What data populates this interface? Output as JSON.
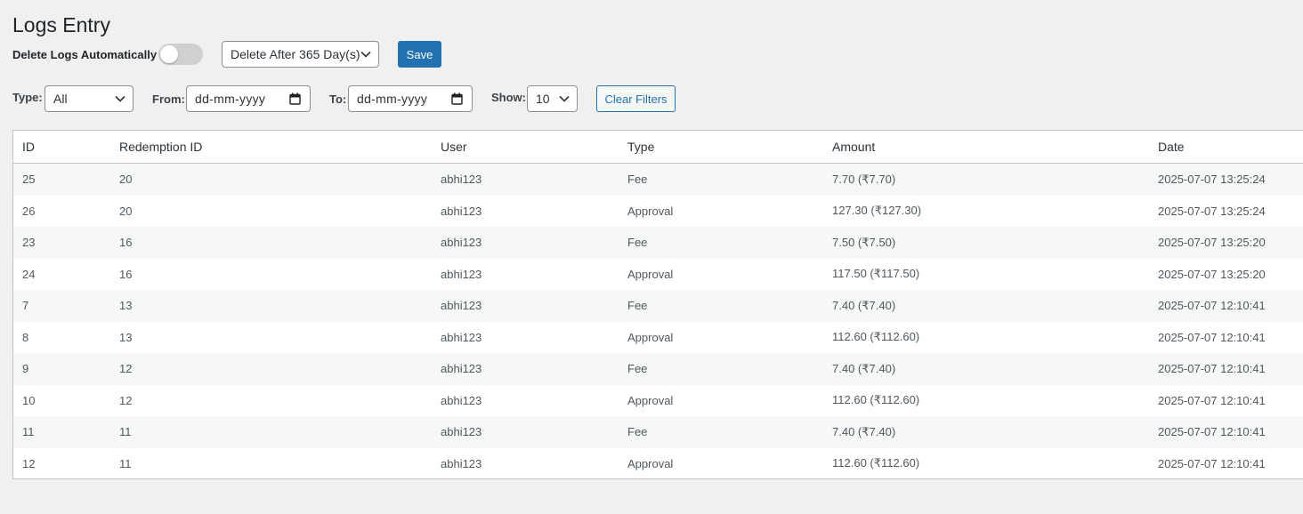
{
  "page": {
    "title": "Logs Entry"
  },
  "settings": {
    "auto_delete_label": "Delete Logs Automatically",
    "auto_delete_enabled": false,
    "delete_after_value": "Delete After 365 Day(s)",
    "save_label": "Save"
  },
  "filters": {
    "type_label": "Type:",
    "type_value": "All",
    "from_label": "From:",
    "from_placeholder": "dd-mm-yyyy",
    "to_label": "To:",
    "to_placeholder": "dd-mm-yyyy",
    "show_label": "Show:",
    "show_value": "10",
    "clear_label": "Clear Filters"
  },
  "table": {
    "headers": [
      "ID",
      "Redemption ID",
      "User",
      "Type",
      "Amount",
      "Date"
    ],
    "rows": [
      [
        "25",
        "20",
        "abhi123",
        "Fee",
        "7.70 (₹7.70)",
        "2025-07-07 13:25:24"
      ],
      [
        "26",
        "20",
        "abhi123",
        "Approval",
        "127.30 (₹127.30)",
        "2025-07-07 13:25:24"
      ],
      [
        "23",
        "16",
        "abhi123",
        "Fee",
        "7.50 (₹7.50)",
        "2025-07-07 13:25:20"
      ],
      [
        "24",
        "16",
        "abhi123",
        "Approval",
        "117.50 (₹117.50)",
        "2025-07-07 13:25:20"
      ],
      [
        "7",
        "13",
        "abhi123",
        "Fee",
        "7.40 (₹7.40)",
        "2025-07-07 12:10:41"
      ],
      [
        "8",
        "13",
        "abhi123",
        "Approval",
        "112.60 (₹112.60)",
        "2025-07-07 12:10:41"
      ],
      [
        "9",
        "12",
        "abhi123",
        "Fee",
        "7.40 (₹7.40)",
        "2025-07-07 12:10:41"
      ],
      [
        "10",
        "12",
        "abhi123",
        "Approval",
        "112.60 (₹112.60)",
        "2025-07-07 12:10:41"
      ],
      [
        "11",
        "11",
        "abhi123",
        "Fee",
        "7.40 (₹7.40)",
        "2025-07-07 12:10:41"
      ],
      [
        "12",
        "11",
        "abhi123",
        "Approval",
        "112.60 (₹112.60)",
        "2025-07-07 12:10:41"
      ]
    ]
  },
  "colors": {
    "primary": "#2271b1",
    "background": "#f0f0f1",
    "row_stripe": "#f6f7f7",
    "border": "#c3c4c7"
  },
  "icons": {
    "dropdown": "chevron-down-icon",
    "date": "calendar-icon"
  }
}
